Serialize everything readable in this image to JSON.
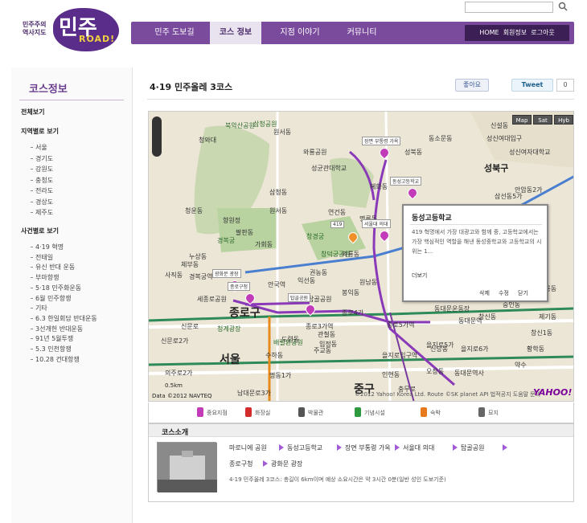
{
  "logo": {
    "small": "민주주의\n역사지도",
    "big": "민주",
    "road": "ROAD!"
  },
  "search": {
    "placeholder": ""
  },
  "nav": {
    "tabs": [
      "민주 도보길",
      "코스 정보",
      "지점 이야기",
      "커뮤니티"
    ],
    "active_index": 1,
    "util": [
      "HOME",
      "회원정보",
      "로그아웃"
    ]
  },
  "sidebar": {
    "title": "코스정보",
    "all": "전체보기",
    "region_header": "지역별로 보기",
    "regions": [
      "서울",
      "경기도",
      "강원도",
      "충청도",
      "전라도",
      "경상도",
      "제주도"
    ],
    "event_header": "사건별로 보기",
    "events": [
      "4·19 혁명",
      "전태일",
      "유신 반대 운동",
      "부마항쟁",
      "5·18 민주화운동",
      "6월 민주항쟁",
      "기타",
      "6.3 한일회담 반대운동",
      "3선개헌 반대운동",
      "91년 5월투쟁",
      "5.3 인천항쟁",
      "10.28 건대항쟁"
    ]
  },
  "main": {
    "title": "4·19 민주올레 3코스",
    "like": "좋아요",
    "tweet": "Tweet",
    "count": "0"
  },
  "map": {
    "buttons": [
      "Map",
      "Sat",
      "Hyb"
    ],
    "labels": [
      {
        "t": "북악산공원",
        "k": "green"
      },
      {
        "t": "삼청공원",
        "k": "green"
      },
      {
        "t": "성북동",
        "k": ""
      },
      {
        "t": "동소문동",
        "k": ""
      },
      {
        "t": "성신여대입구",
        "k": ""
      },
      {
        "t": "성신여자대학교",
        "k": ""
      },
      {
        "t": "성북구",
        "k": "mid"
      },
      {
        "t": "신설동",
        "k": ""
      },
      {
        "t": "삼청동",
        "k": ""
      },
      {
        "t": "원서동",
        "k": ""
      },
      {
        "t": "와룡공원",
        "k": ""
      },
      {
        "t": "성균관대학교",
        "k": ""
      },
      {
        "t": "혜화동",
        "k": ""
      },
      {
        "t": "명륜동",
        "k": ""
      },
      {
        "t": "향원정",
        "k": ""
      },
      {
        "t": "팔판동",
        "k": ""
      },
      {
        "t": "청운동",
        "k": ""
      },
      {
        "t": "경복궁",
        "k": "green"
      },
      {
        "t": "가회동",
        "k": ""
      },
      {
        "t": "창덕궁공원",
        "k": "green"
      },
      {
        "t": "창경궁",
        "k": "green"
      },
      {
        "t": "연건동",
        "k": ""
      },
      {
        "t": "와룡동",
        "k": ""
      },
      {
        "t": "종로구",
        "k": "big"
      },
      {
        "t": "세종로공원",
        "k": ""
      },
      {
        "t": "청계광장",
        "k": "green"
      },
      {
        "t": "탑골공원",
        "k": ""
      },
      {
        "t": "익선동",
        "k": ""
      },
      {
        "t": "권농동",
        "k": ""
      },
      {
        "t": "원남동",
        "k": ""
      },
      {
        "t": "종로5가역",
        "k": ""
      },
      {
        "t": "종로3가역",
        "k": ""
      },
      {
        "t": "동대문역",
        "k": ""
      },
      {
        "t": "신문로",
        "k": ""
      },
      {
        "t": "서울",
        "k": "big"
      },
      {
        "t": "중구",
        "k": "big"
      },
      {
        "t": "을지로입구역",
        "k": ""
      },
      {
        "t": "명동1가",
        "k": ""
      },
      {
        "t": "남대문로3가",
        "k": ""
      },
      {
        "t": "충무로",
        "k": ""
      },
      {
        "t": "신당동",
        "k": ""
      },
      {
        "t": "동대문운동장",
        "k": ""
      },
      {
        "t": "창신동",
        "k": ""
      },
      {
        "t": "숭인동",
        "k": ""
      },
      {
        "t": "안암동2가",
        "k": ""
      },
      {
        "t": "용두동",
        "k": ""
      },
      {
        "t": "청룡동",
        "k": ""
      },
      {
        "t": "누상동",
        "k": ""
      },
      {
        "t": "체부동",
        "k": ""
      },
      {
        "t": "사직동",
        "k": ""
      },
      {
        "t": "의주로2가",
        "k": ""
      },
      {
        "t": "신문로2가",
        "k": ""
      },
      {
        "t": "도렴동",
        "k": ""
      },
      {
        "t": "관철동",
        "k": ""
      },
      {
        "t": "인현동",
        "k": ""
      },
      {
        "t": "주교동",
        "k": ""
      },
      {
        "t": "을지로5가",
        "k": ""
      },
      {
        "t": "황학동",
        "k": ""
      },
      {
        "t": "창신1동",
        "k": ""
      },
      {
        "t": "제기동",
        "k": ""
      },
      {
        "t": "수하동",
        "k": ""
      },
      {
        "t": "배렬환공원",
        "k": "green"
      },
      {
        "t": "청와대",
        "k": ""
      },
      {
        "t": "삼선동5가",
        "k": ""
      },
      {
        "t": "동선동",
        "k": ""
      },
      {
        "t": "입정동",
        "k": ""
      },
      {
        "t": "오장동",
        "k": ""
      },
      {
        "t": "을지로6가",
        "k": ""
      },
      {
        "t": "약수",
        "k": ""
      },
      {
        "t": "동대문역사",
        "k": ""
      },
      {
        "t": "종로4가",
        "k": ""
      },
      {
        "t": "원서동",
        "k": ""
      },
      {
        "t": "봉익동",
        "k": ""
      },
      {
        "t": "신설동",
        "k": ""
      },
      {
        "t": "안국역",
        "k": ""
      },
      {
        "t": "경복궁역",
        "k": ""
      }
    ],
    "markers": [
      {
        "label": "장면 부통령 가옥"
      },
      {
        "label": "동성고등학교"
      },
      {
        "label": "419"
      },
      {
        "label": "서울대 의대"
      },
      {
        "label": "광화문 광장"
      },
      {
        "label": "종로구청"
      },
      {
        "label": "탑골공원"
      }
    ],
    "popup": {
      "title": "동성고등학교",
      "body": "419 혁명에서 가장 대광고와 함께 중, 고등학교에서는 가장 핵심적인 역할을 해낸 동성중학교와 고등학교의 시위는 1...",
      "more": "더보기",
      "actions": [
        "삭제",
        "수정",
        "닫기"
      ]
    },
    "scale": "0.5km",
    "data_label": "Data ©2012 NAVTEQ",
    "copyright": "©2012 Yahoo! Korea Ltd. Route ©SK planet API 법적공지 도움말 문의",
    "yahoo": "YAHOO!"
  },
  "legend": [
    {
      "label": "중요지점",
      "color": "#c23bb8"
    },
    {
      "label": "화장실",
      "color": "#d42b2b"
    },
    {
      "label": "박물관",
      "color": "#555555"
    },
    {
      "label": "기념시설",
      "color": "#2e9a3e"
    },
    {
      "label": "숙박",
      "color": "#e87a1e"
    },
    {
      "label": "묘지",
      "color": "#666666"
    }
  ],
  "course": {
    "title": "코스소개",
    "route": [
      "마로니에 공원",
      "동성고등학교",
      "장면 부통령 가옥",
      "서울대 의대",
      "탑골공원",
      "종로구청",
      "광화문 광장"
    ],
    "desc": "4·19 민주올레 3코스: 총길이 6km이며 예상 소요시간은 약 3시간 0분(일반 성인 도보기준)"
  },
  "colors": {
    "brand": "#7a4a9c",
    "route": "#8a3ab8",
    "marker": "#c23bb8"
  }
}
